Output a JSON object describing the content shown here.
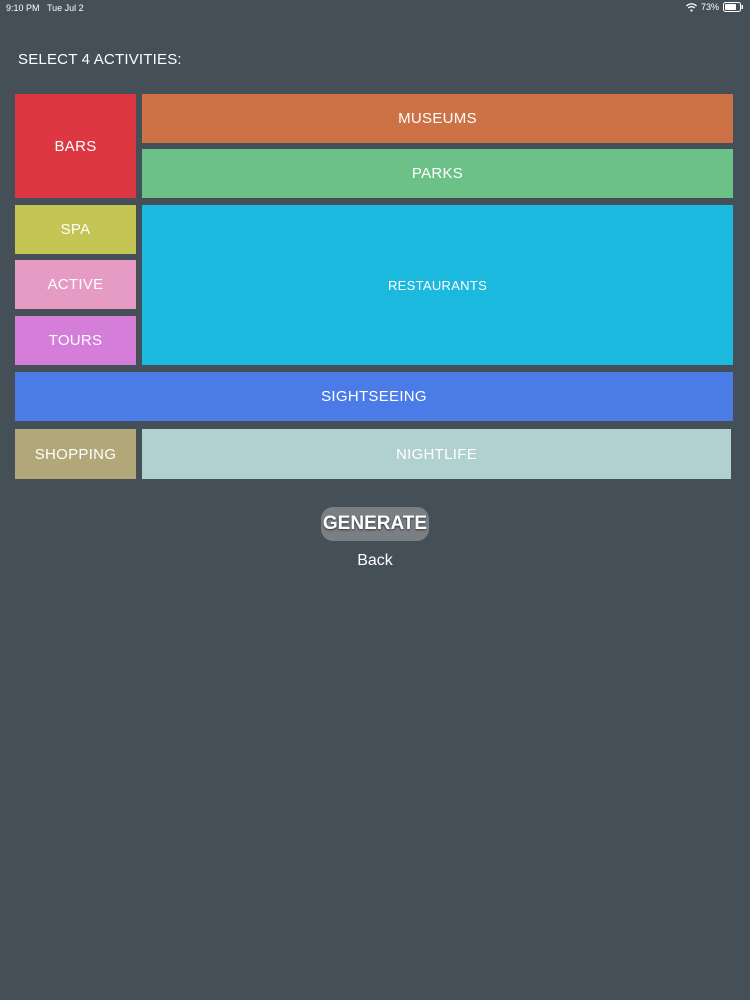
{
  "status_bar": {
    "time": "9:10 PM",
    "date": "Tue Jul 2",
    "battery": "73%",
    "icons": [
      "wifi-icon",
      "battery-icon"
    ]
  },
  "title": "SELECT 4 ACTIVITIES:",
  "activities": {
    "bars": {
      "label": "BARS",
      "color": "#dd3842"
    },
    "museums": {
      "label": "MUSEUMS",
      "color": "#cd7246"
    },
    "parks": {
      "label": "PARKS",
      "color": "#6bc188"
    },
    "spa": {
      "label": "SPA",
      "color": "#c4c555"
    },
    "active": {
      "label": "ACTIVE",
      "color": "#e59bc3"
    },
    "tours": {
      "label": "TOURS",
      "color": "#d57ed9"
    },
    "restaurants": {
      "label": "RESTAURANTS",
      "color": "#1cb9de"
    },
    "sightseeing": {
      "label": "SIGHTSEEING",
      "color": "#4b7be7"
    },
    "shopping": {
      "label": "SHOPPING",
      "color": "#b2a778"
    },
    "nightlife": {
      "label": "NIGHTLIFE",
      "color": "#b1d0d0"
    }
  },
  "actions": {
    "generate_label": "GENERATE",
    "back_label": "Back"
  }
}
